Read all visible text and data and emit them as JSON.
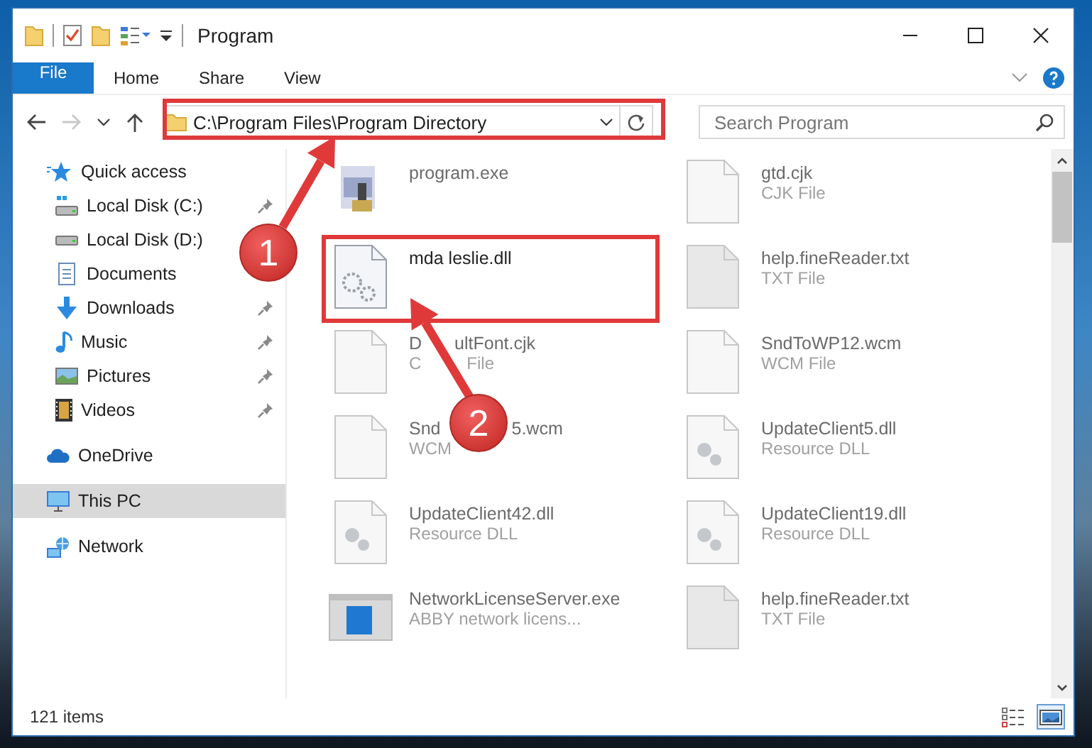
{
  "window": {
    "title": "Program"
  },
  "ribbon": {
    "tabs": [
      {
        "label": "File",
        "kind": "file",
        "selected": false
      },
      {
        "label": "Home",
        "kind": "tab",
        "selected": false
      },
      {
        "label": "Share",
        "kind": "tab",
        "selected": false
      },
      {
        "label": "View",
        "kind": "tab",
        "selected": false
      }
    ]
  },
  "nav_buttons": [
    {
      "kind": "back",
      "disabled": false
    },
    {
      "kind": "forward",
      "disabled": true
    },
    {
      "kind": "recent",
      "disabled": false
    },
    {
      "kind": "up",
      "disabled": false
    }
  ],
  "address": {
    "path": "C:\\Program Files\\Program Directory"
  },
  "search": {
    "placeholder": "Search Program"
  },
  "sidebar": {
    "items": [
      {
        "label": "Quick access",
        "kind": "star",
        "selected": false,
        "pinned": false,
        "children": [
          {
            "label": "Local Disk (C:)",
            "kind": "drive-c",
            "selected": false,
            "pinned": true
          },
          {
            "label": "Local Disk (D:)",
            "kind": "drive",
            "selected": false,
            "pinned": false
          },
          {
            "label": "Documents",
            "kind": "documents",
            "selected": false,
            "pinned": false
          },
          {
            "label": "Downloads",
            "kind": "downloads",
            "selected": false,
            "pinned": true
          },
          {
            "label": "Music",
            "kind": "music",
            "selected": false,
            "pinned": true
          },
          {
            "label": "Pictures",
            "kind": "pictures",
            "selected": false,
            "pinned": true
          },
          {
            "label": "Videos",
            "kind": "videos",
            "selected": false,
            "pinned": true
          }
        ]
      },
      {
        "label": "OneDrive",
        "kind": "cloud",
        "selected": false,
        "pinned": false
      },
      {
        "label": "This PC",
        "kind": "pc",
        "selected": true,
        "pinned": false
      },
      {
        "label": "Network",
        "kind": "network",
        "selected": false,
        "pinned": false
      }
    ]
  },
  "files": [
    {
      "name_parts": [
        "program.exe"
      ],
      "kind": "app",
      "blurred": true
    },
    {
      "name_parts": [
        "gtd.cjk"
      ],
      "type_parts": [
        "CJK File"
      ],
      "kind": "blank",
      "blurred": true
    },
    {
      "name_parts": [
        "mda leslie.dll"
      ],
      "kind": "gears",
      "blurred": false
    },
    {
      "name_parts": [
        "help.fineReader.txt"
      ],
      "type_parts": [
        "TXT File"
      ],
      "kind": "text",
      "blurred": true
    },
    {
      "name_parts": [
        "D",
        "ultFont.cjk"
      ],
      "type_parts": [
        "C",
        "File"
      ],
      "kind": "blank",
      "blurred": true
    },
    {
      "name_parts": [
        "SndToWP12.wcm"
      ],
      "type_parts": [
        "WCM File"
      ],
      "kind": "blank",
      "blurred": true
    },
    {
      "name_parts": [
        "Snd",
        "5.wcm"
      ],
      "type_parts": [
        "WCM"
      ],
      "kind": "blank",
      "blurred": true
    },
    {
      "name_parts": [
        "UpdateClient5.dll"
      ],
      "type_parts": [
        "Resource DLL"
      ],
      "kind": "dll",
      "blurred": true
    },
    {
      "name_parts": [
        "UpdateClient42.dll"
      ],
      "type_parts": [
        "Resource DLL"
      ],
      "kind": "dll",
      "blurred": true
    },
    {
      "name_parts": [
        "UpdateClient19.dll"
      ],
      "type_parts": [
        "Resource DLL"
      ],
      "kind": "dll",
      "blurred": true
    },
    {
      "name_parts": [
        "NetworkLicenseServer.exe"
      ],
      "type_parts": [
        "ABBY network licens..."
      ],
      "kind": "window",
      "blurred": true
    },
    {
      "name_parts": [
        "help.fineReader.txt"
      ],
      "type_parts": [
        "TXT File"
      ],
      "kind": "text",
      "blurred": true
    }
  ],
  "status_bar": {
    "count": "121 items",
    "views": [
      {
        "kind": "details",
        "selected": false
      },
      {
        "kind": "large-icons",
        "selected": true
      }
    ]
  },
  "annotations": [
    {
      "number": "1"
    },
    {
      "number": "2"
    }
  ]
}
